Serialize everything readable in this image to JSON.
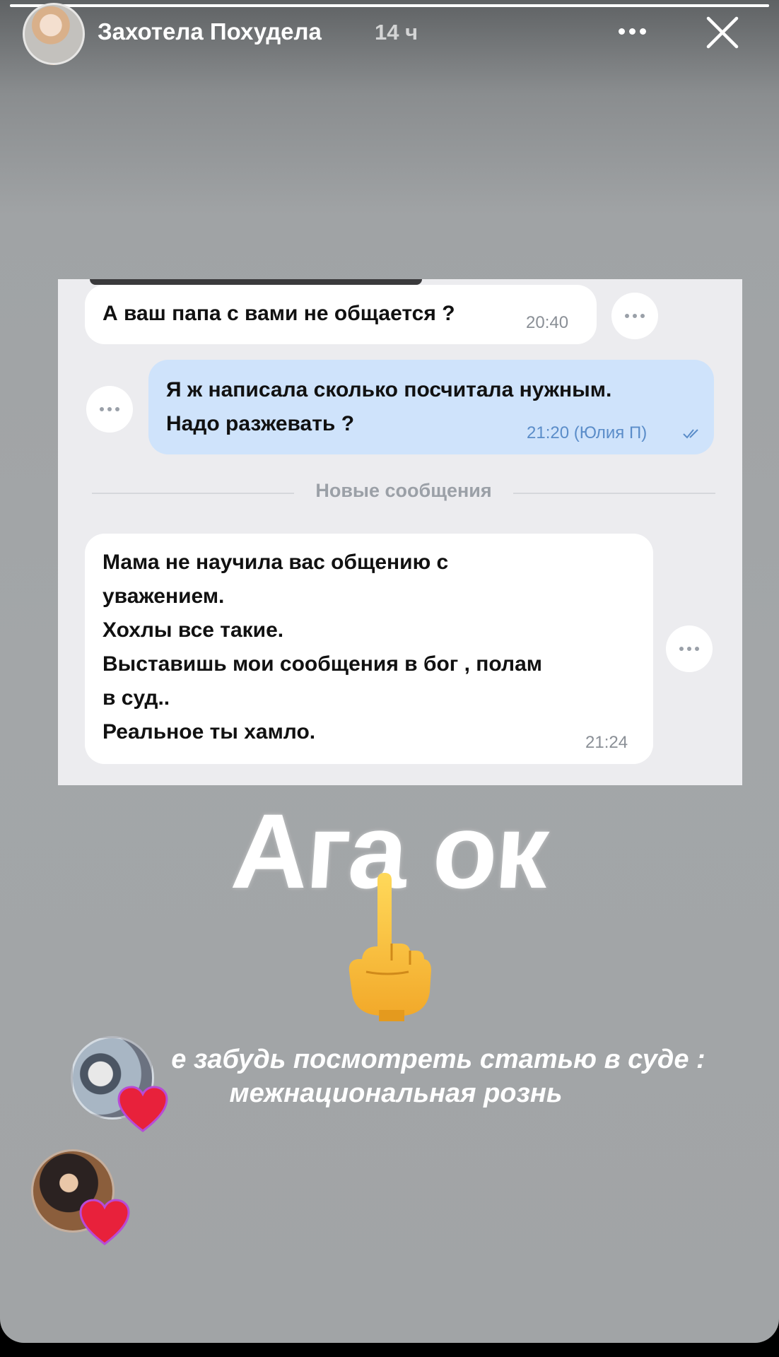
{
  "story": {
    "progress_fraction": 1.0,
    "header": {
      "username": "Захотела Похудела",
      "time_ago": "14 ч",
      "more_icon": "more-horizontal-icon",
      "close_icon": "close-icon"
    },
    "chat": {
      "msg1": {
        "text": "А ваш папа с вами не общается ?",
        "time": "20:40"
      },
      "msg2": {
        "line1": "Я ж написала сколько посчитала нужным.",
        "line2": "Надо разжевать ?",
        "time": "21:20 (Юлия П)"
      },
      "divider": "Новые сообщения",
      "msg3": {
        "line1": "Мама не научила вас общению с",
        "line2": "уважением.",
        "line3": "Хохлы все такие.",
        "line4": "Выставишь мои сообщения в бог , полам",
        "line5": "в суд..",
        "line6": "Реальное ты хамло.",
        "time": "21:24"
      }
    },
    "overlay": {
      "big_text": "Ага ок",
      "emoji": "middle-finger-emoji",
      "caption_line1": "е забудь посмотреть статью в суде :",
      "caption_line2": "межнациональная рознь"
    },
    "reactions": [
      {
        "icon": "heart-icon"
      },
      {
        "icon": "heart-icon"
      }
    ]
  }
}
